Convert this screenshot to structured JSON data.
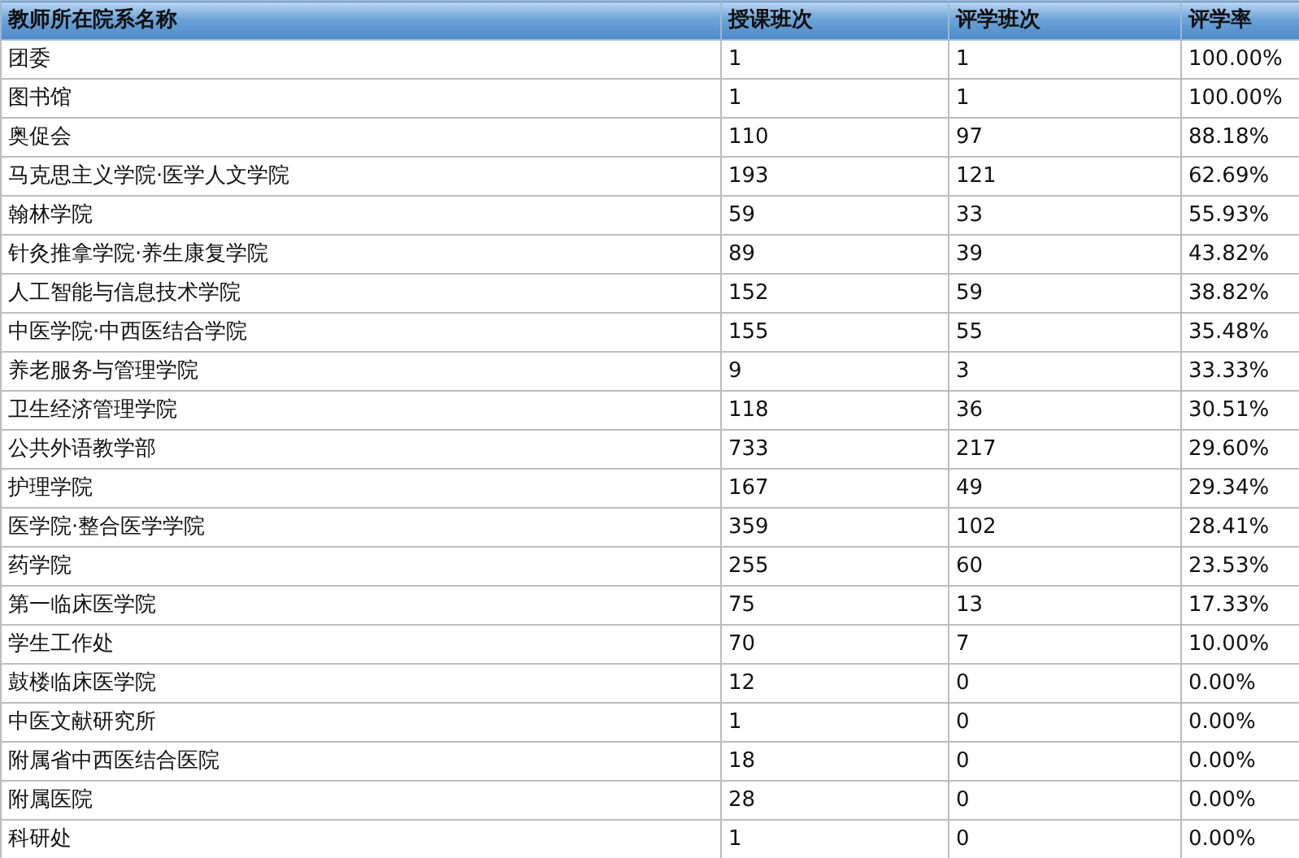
{
  "table": {
    "columns": [
      "教师所在院系名称",
      "授课班次",
      "评学班次",
      "评学率"
    ],
    "rows": [
      [
        "团委",
        "1",
        "1",
        "100.00%"
      ],
      [
        "图书馆",
        "1",
        "1",
        "100.00%"
      ],
      [
        "奥促会",
        "110",
        "97",
        "88.18%"
      ],
      [
        "马克思主义学院·医学人文学院",
        "193",
        "121",
        "62.69%"
      ],
      [
        "翰林学院",
        "59",
        "33",
        "55.93%"
      ],
      [
        "针灸推拿学院·养生康复学院",
        "89",
        "39",
        "43.82%"
      ],
      [
        "人工智能与信息技术学院",
        "152",
        "59",
        "38.82%"
      ],
      [
        "中医学院·中西医结合学院",
        "155",
        "55",
        "35.48%"
      ],
      [
        "养老服务与管理学院",
        "9",
        "3",
        "33.33%"
      ],
      [
        "卫生经济管理学院",
        "118",
        "36",
        "30.51%"
      ],
      [
        "公共外语教学部",
        "733",
        "217",
        "29.60%"
      ],
      [
        "护理学院",
        "167",
        "49",
        "29.34%"
      ],
      [
        "医学院·整合医学学院",
        "359",
        "102",
        "28.41%"
      ],
      [
        "药学院",
        "255",
        "60",
        "23.53%"
      ],
      [
        "第一临床医学院",
        "75",
        "13",
        "17.33%"
      ],
      [
        "学生工作处",
        "70",
        "7",
        "10.00%"
      ],
      [
        "鼓楼临床医学院",
        "12",
        "0",
        "0.00%"
      ],
      [
        "中医文献研究所",
        "1",
        "0",
        "0.00%"
      ],
      [
        "附属省中西医结合医院",
        "18",
        "0",
        "0.00%"
      ],
      [
        "附属医院",
        "28",
        "0",
        "0.00%"
      ],
      [
        "科研处",
        "1",
        "0",
        "0.00%"
      ]
    ]
  }
}
